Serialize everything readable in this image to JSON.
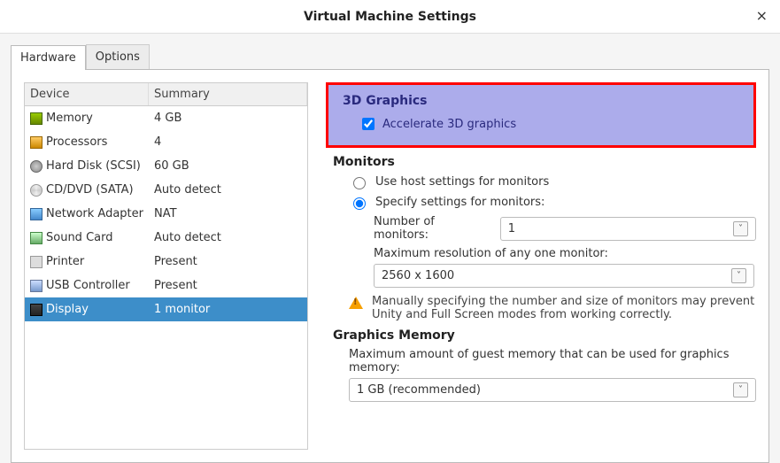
{
  "window": {
    "title": "Virtual Machine Settings"
  },
  "tabs": {
    "hardware": "Hardware",
    "options": "Options"
  },
  "table": {
    "header_device": "Device",
    "header_summary": "Summary",
    "rows": [
      {
        "name": "Memory",
        "summary": "4 GB"
      },
      {
        "name": "Processors",
        "summary": "4"
      },
      {
        "name": "Hard Disk (SCSI)",
        "summary": "60 GB"
      },
      {
        "name": "CD/DVD (SATA)",
        "summary": "Auto detect"
      },
      {
        "name": "Network Adapter",
        "summary": "NAT"
      },
      {
        "name": "Sound Card",
        "summary": "Auto detect"
      },
      {
        "name": "Printer",
        "summary": "Present"
      },
      {
        "name": "USB Controller",
        "summary": "Present"
      },
      {
        "name": "Display",
        "summary": "1 monitor"
      }
    ]
  },
  "graphics3d": {
    "title": "3D Graphics",
    "checkbox_label": "Accelerate 3D graphics"
  },
  "monitors": {
    "title": "Monitors",
    "use_host": "Use host settings for monitors",
    "specify": "Specify settings for monitors:",
    "num_label": "Number of monitors:",
    "num_value": "1",
    "maxres_label": "Maximum resolution of any one monitor:",
    "maxres_value": "2560 x 1600",
    "warning": "Manually specifying the number and size of monitors may prevent Unity and Full Screen modes from working correctly."
  },
  "gmem": {
    "title": "Graphics Memory",
    "label": "Maximum amount of guest memory that can be used for graphics memory:",
    "value": "1 GB (recommended)"
  }
}
